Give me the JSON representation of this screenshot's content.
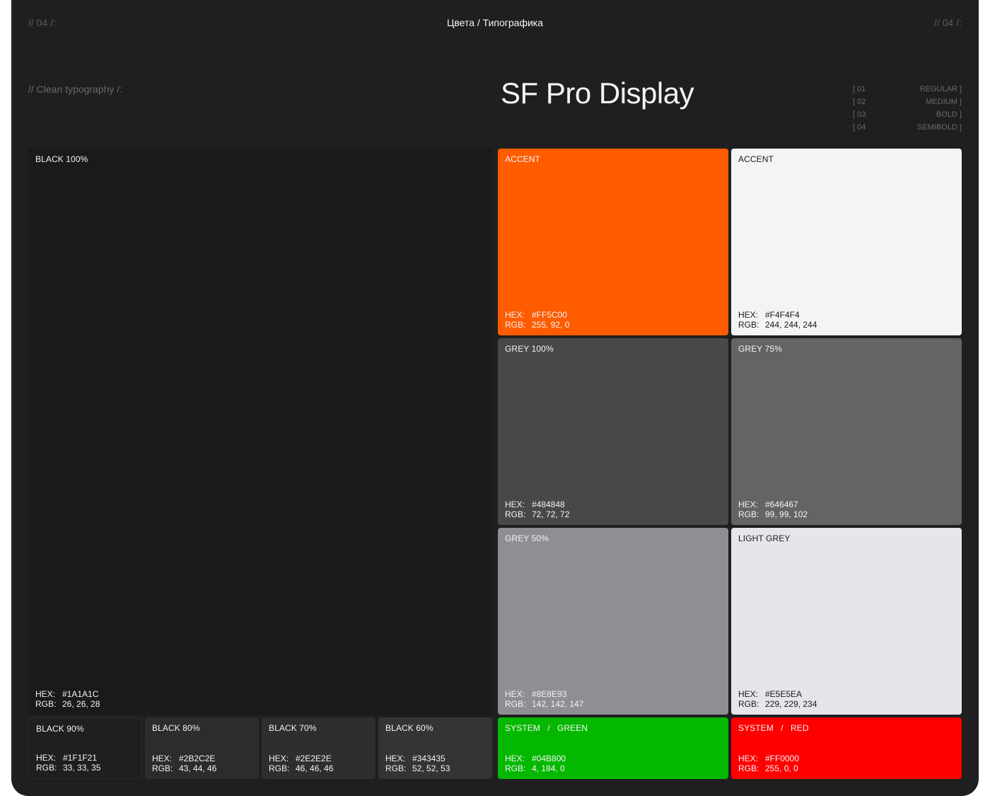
{
  "header": {
    "left_marker": "// 04 /:",
    "title": "Цвета / Типографика",
    "right_marker": "// 04 /:"
  },
  "typography": {
    "subtitle": "// Clean typography /:",
    "font_name": "SF Pro Display",
    "weights": [
      {
        "num": "[ 01",
        "name": "REGULAR ]"
      },
      {
        "num": "[ 02",
        "name": "MEDIUM ]"
      },
      {
        "num": "[ 03",
        "name": "BOLD ]"
      },
      {
        "num": "[ 04",
        "name": "SEMIBOLD ]"
      }
    ]
  },
  "labels": {
    "hex": "HEX:",
    "rgb": "RGB:"
  },
  "swatches": {
    "black100": {
      "label": "BLACK 100%",
      "hex": "#1A1A1C",
      "rgb": "26, 26, 28",
      "color": "#1a1a1c"
    },
    "accent_orange": {
      "label": "ACCENT",
      "hex": "#FF5C00",
      "rgb": "255, 92, 0",
      "color": "#ff5c00"
    },
    "accent_white": {
      "label": "ACCENT",
      "hex": "#F4F4F4",
      "rgb": "244, 244, 244",
      "color": "#f4f4f4"
    },
    "grey100": {
      "label": "GREY 100%",
      "hex": "#484848",
      "rgb": "72, 72, 72",
      "color": "#484848"
    },
    "grey75": {
      "label": "GREY 75%",
      "hex": "#646467",
      "rgb": "99, 99, 102",
      "color": "#646467"
    },
    "grey50": {
      "label": "GREY 50%",
      "hex": "#8E8E93",
      "rgb": "142, 142, 147",
      "color": "#8e8e93"
    },
    "light_grey": {
      "label": "LIGHT GREY",
      "hex": "#E5E5EA",
      "rgb": "229, 229, 234",
      "color": "#e5e5ea"
    },
    "black90": {
      "label": "BLACK 90%",
      "hex": "#1F1F21",
      "rgb": "33, 33, 35",
      "color": "#1f1f21"
    },
    "black80": {
      "label": "BLACK 80%",
      "hex": "#2B2C2E",
      "rgb": "43, 44, 46",
      "color": "#2b2c2e"
    },
    "black70": {
      "label": "BLACK 70%",
      "hex": "#2E2E2E",
      "rgb": "46, 46, 46",
      "color": "#2e2e2e"
    },
    "black60": {
      "label": "BLACK 60%",
      "hex": "#343435",
      "rgb": "52, 52, 53",
      "color": "#343435"
    },
    "green": {
      "label": "SYSTEM   /   GREEN",
      "hex": "#04B800",
      "rgb": "4, 184, 0",
      "color": "#04b800"
    },
    "red": {
      "label": "SYSTEM   /   RED",
      "hex": "#FF0000",
      "rgb": "255, 0, 0",
      "color": "#ff0000"
    }
  }
}
